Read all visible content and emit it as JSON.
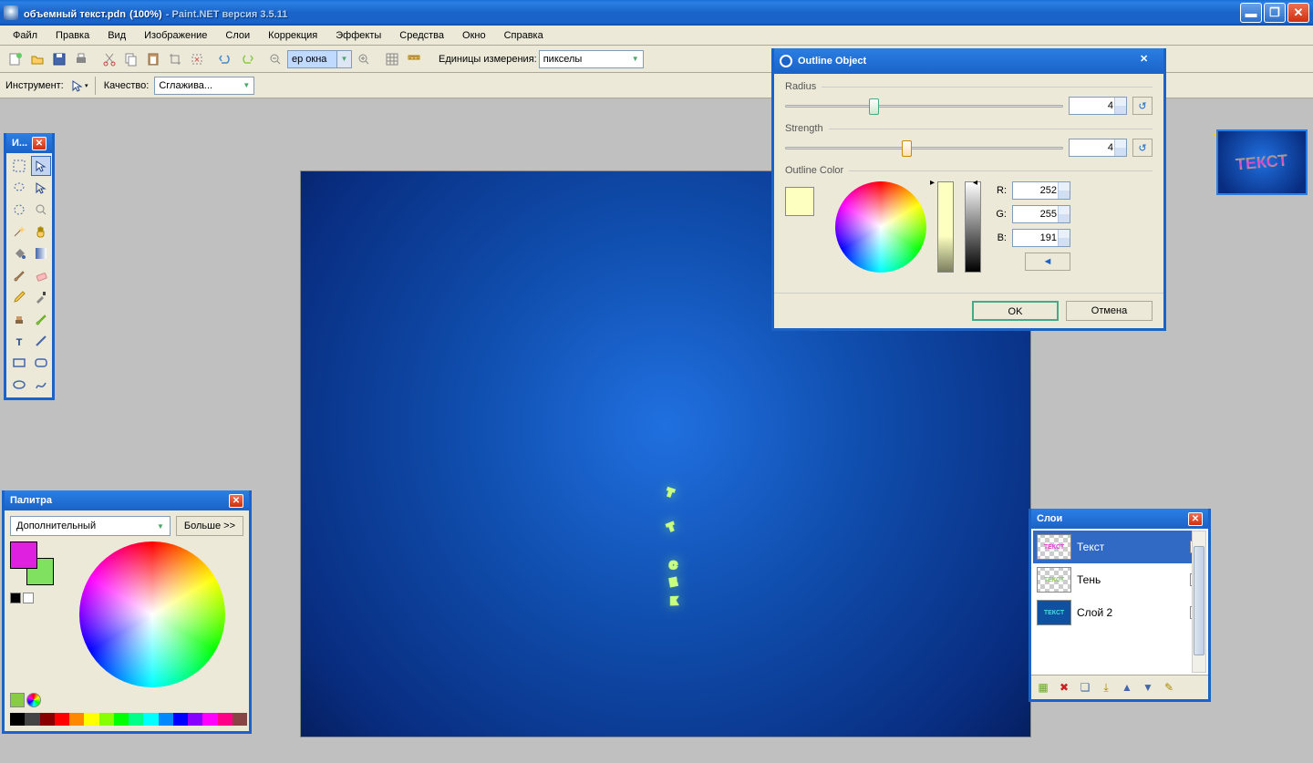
{
  "title": {
    "file": "объемный текст.pdn",
    "zoom": "(100%)",
    "app": "Paint.NET версия 3.5.11"
  },
  "menu": {
    "file": "Файл",
    "edit": "Правка",
    "view": "Вид",
    "image": "Изображение",
    "layers": "Слои",
    "adjust": "Коррекция",
    "effects": "Эффекты",
    "tools": "Средства",
    "window": "Окно",
    "help": "Справка"
  },
  "toolbar": {
    "zoom_input": "ер окна",
    "units_label": "Единицы измерения:",
    "units_value": "пикселы"
  },
  "toolbar2": {
    "instr_label": "Инструмент:",
    "quality_label": "Качество:",
    "quality_value": "Сглажива..."
  },
  "tools_panel": {
    "title": "И..."
  },
  "palette": {
    "title": "Палитра",
    "mode": "Дополнительный",
    "more": "Больше >>"
  },
  "layers_panel": {
    "title": "Слои",
    "items": [
      {
        "name": "Текст",
        "checked": true
      },
      {
        "name": "Тень",
        "checked": true
      },
      {
        "name": "Слой 2",
        "checked": false
      }
    ]
  },
  "dialog": {
    "title": "Outline Object",
    "radius_label": "Radius",
    "radius_value": "4",
    "strength_label": "Strength",
    "strength_value": "4",
    "color_label": "Outline Color",
    "rgb": {
      "r_label": "R:",
      "r": "252",
      "g_label": "G:",
      "g": "255",
      "b_label": "B:",
      "b": "191"
    },
    "ok": "OK",
    "cancel": "Отмена"
  },
  "canvas_text": "ТЕКСТ",
  "icons": {
    "reset": "↺",
    "arrow": "◄"
  }
}
